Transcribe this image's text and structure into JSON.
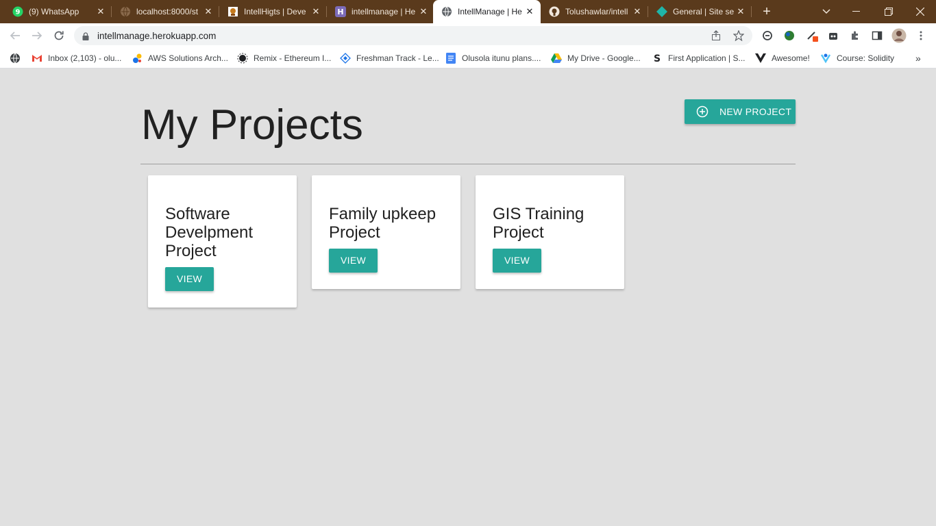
{
  "browser": {
    "tabs": [
      {
        "title": "(9) WhatsApp",
        "icon": "whatsapp-icon"
      },
      {
        "title": "localhost:8000/st",
        "icon": "globe-icon"
      },
      {
        "title": "IntellHigts | Deve",
        "icon": "site-icon"
      },
      {
        "title": "intellmanage | He",
        "icon": "heroku-icon"
      },
      {
        "title": "IntellManage | He",
        "icon": "globe-icon",
        "active": true
      },
      {
        "title": "Tolushawlar/intell",
        "icon": "github-icon"
      },
      {
        "title": "General | Site sett",
        "icon": "netlify-icon"
      }
    ],
    "url": "intellmanage.herokuapp.com",
    "bookmarks": [
      {
        "label": "Inbox (2,103) - olu...",
        "icon": "gmail-icon"
      },
      {
        "label": "AWS Solutions Arch...",
        "icon": "aws-icon"
      },
      {
        "label": "Remix - Ethereum I...",
        "icon": "remix-icon"
      },
      {
        "label": "Freshman Track - Le...",
        "icon": "diamond-icon"
      },
      {
        "label": "Olusola itunu plans....",
        "icon": "docs-icon"
      },
      {
        "label": "My Drive - Google...",
        "icon": "drive-icon"
      },
      {
        "label": "First Application | S...",
        "icon": "strapi-icon"
      },
      {
        "label": "Awesome!",
        "icon": "vue-icon"
      },
      {
        "label": "Course: Solidity",
        "icon": "course-icon"
      }
    ]
  },
  "page": {
    "heading": "My Projects",
    "new_project_label": "NEW PROJECT",
    "projects": [
      {
        "title": "Software Develpment Project",
        "view_label": "VIEW"
      },
      {
        "title": "Family upkeep Project",
        "view_label": "VIEW"
      },
      {
        "title": "GIS Training Project",
        "view_label": "VIEW"
      }
    ]
  },
  "colors": {
    "accent": "#26a69a",
    "page_background": "#e0e0e0",
    "tabstrip": "#5a3a1c"
  }
}
